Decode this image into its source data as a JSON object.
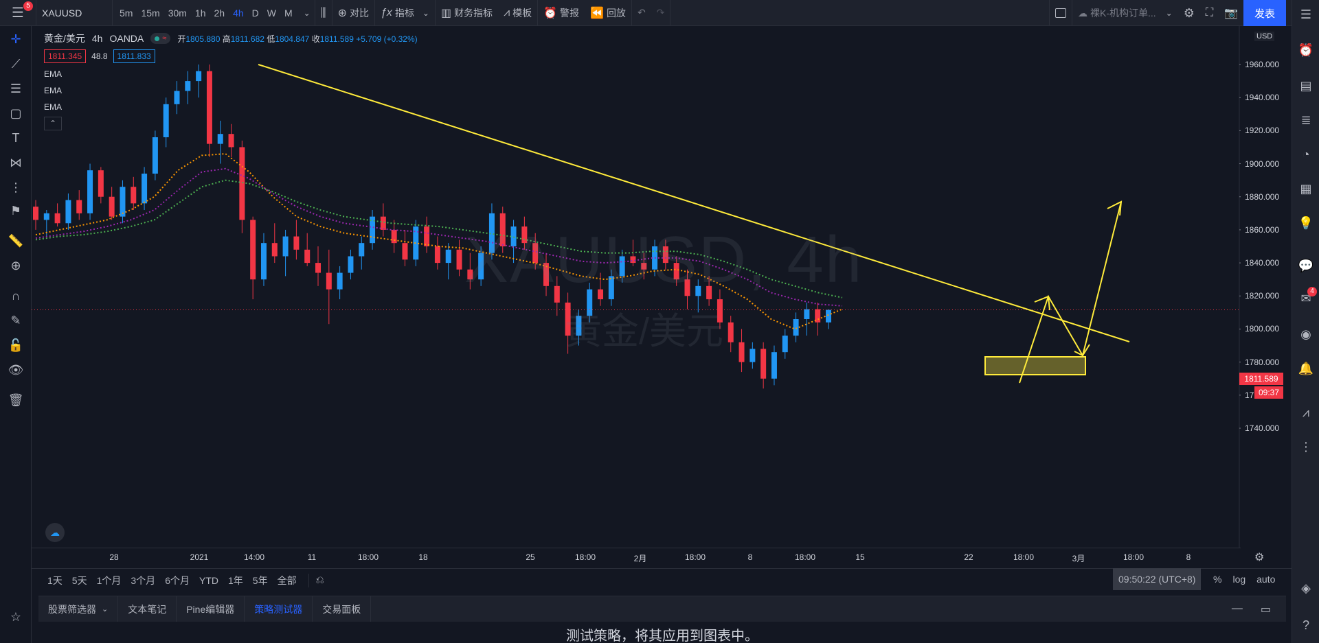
{
  "topbar": {
    "menu_badge": "5",
    "symbol": "XAUUSD",
    "timeframes": [
      "5m",
      "15m",
      "30m",
      "1h",
      "2h",
      "4h",
      "D",
      "W",
      "M"
    ],
    "active_timeframe": "4h",
    "compare_label": "对比",
    "indicators_label": "指标",
    "financials_label": "财务指标",
    "templates_label": "模板",
    "alerts_label": "警报",
    "replay_label": "回放",
    "layout_name": "裸K-机构订单...",
    "publish_label": "发表"
  },
  "legend": {
    "title": "黄金/美元",
    "interval": "4h",
    "broker": "OANDA",
    "open_label": "开",
    "open": "1805.880",
    "high_label": "高",
    "high": "1811.682",
    "low_label": "低",
    "low": "1804.847",
    "close_label": "收",
    "close": "1811.589",
    "change": "+5.709 (+0.32%)",
    "bid": "1811.345",
    "spread": "48.8",
    "ask": "1811.833",
    "indicators": [
      "EMA",
      "EMA",
      "EMA"
    ]
  },
  "watermark": {
    "symbol": "XAUUSD, 4h",
    "name": "黄金/美元"
  },
  "price_axis": {
    "currency": "USD",
    "labels": [
      "1960.000",
      "1940.000",
      "1920.000",
      "1900.000",
      "1880.000",
      "1860.000",
      "1840.000",
      "1820.000",
      "1800.000",
      "1780.000",
      "1760.000",
      "1740.000"
    ],
    "current_price": "1811.589",
    "countdown": "09:37"
  },
  "time_axis": {
    "labels": [
      "28",
      "2021",
      "14:00",
      "11",
      "18:00",
      "18",
      "25",
      "18:00",
      "2月",
      "18:00",
      "8",
      "18:00",
      "15",
      "22",
      "18:00",
      "3月",
      "18:00",
      "8"
    ]
  },
  "range_bar": {
    "ranges": [
      "1天",
      "5天",
      "1个月",
      "3个月",
      "6个月",
      "YTD",
      "1年",
      "5年",
      "全部"
    ],
    "clock": "09:50:22 (UTC+8)",
    "scale_percent": "%",
    "scale_log": "log",
    "scale_auto": "auto"
  },
  "bottom_panel": {
    "tabs": [
      "股票筛选器",
      "文本笔记",
      "Pine编辑器",
      "策略测试器",
      "交易面板"
    ],
    "active_tab": "策略测试器",
    "message": "测试策略，将其应用到图表中。"
  },
  "right_toolbar": {
    "badge": "4"
  },
  "colors": {
    "background": "#131722",
    "up": "#2196f3",
    "down": "#f23645",
    "ema_fast": "#ff9800",
    "ema_mid": "#9c27b0",
    "ema_slow": "#4caf50",
    "drawing": "#ffeb3b",
    "accent": "#2962ff"
  },
  "chart_data": {
    "type": "candlestick",
    "symbol": "XAUUSD",
    "interval": "4h",
    "ylim": [
      1730,
      1990
    ],
    "y_ticks": [
      1740,
      1760,
      1780,
      1800,
      1820,
      1840,
      1860,
      1880,
      1900,
      1920,
      1940,
      1960
    ],
    "last_price": 1811.589,
    "series": [
      {
        "name": "EMA",
        "color": "#ff9800",
        "values": [
          1857,
          1860,
          1863,
          1866,
          1872,
          1880,
          1896,
          1905,
          1906,
          1895,
          1880,
          1868,
          1862,
          1858,
          1856,
          1854,
          1852,
          1850,
          1849,
          1846,
          1843,
          1840,
          1836,
          1832,
          1830,
          1832,
          1835,
          1836,
          1833,
          1826,
          1818,
          1806,
          1800,
          1806,
          1812
        ]
      },
      {
        "name": "EMA",
        "color": "#9c27b0",
        "values": [
          1855,
          1857,
          1859,
          1862,
          1866,
          1872,
          1884,
          1895,
          1897,
          1891,
          1882,
          1874,
          1868,
          1864,
          1862,
          1860,
          1859,
          1857,
          1855,
          1853,
          1850,
          1847,
          1844,
          1841,
          1840,
          1841,
          1843,
          1843,
          1841,
          1836,
          1830,
          1822,
          1818,
          1815,
          1814
        ]
      },
      {
        "name": "EMA",
        "color": "#4caf50",
        "values": [
          1854,
          1856,
          1857,
          1859,
          1862,
          1866,
          1876,
          1886,
          1890,
          1888,
          1883,
          1877,
          1872,
          1868,
          1866,
          1864,
          1863,
          1862,
          1860,
          1858,
          1856,
          1853,
          1850,
          1847,
          1846,
          1846,
          1847,
          1847,
          1845,
          1841,
          1836,
          1830,
          1826,
          1822,
          1819
        ]
      }
    ],
    "candles": [
      [
        1874,
        1878,
        1860,
        1866
      ],
      [
        1866,
        1872,
        1856,
        1870
      ],
      [
        1870,
        1876,
        1862,
        1864
      ],
      [
        1864,
        1882,
        1860,
        1878
      ],
      [
        1878,
        1884,
        1866,
        1870
      ],
      [
        1870,
        1900,
        1866,
        1896
      ],
      [
        1896,
        1898,
        1876,
        1880
      ],
      [
        1880,
        1886,
        1866,
        1868
      ],
      [
        1868,
        1890,
        1864,
        1886
      ],
      [
        1886,
        1892,
        1872,
        1876
      ],
      [
        1876,
        1898,
        1872,
        1894
      ],
      [
        1894,
        1920,
        1890,
        1916
      ],
      [
        1916,
        1940,
        1910,
        1936
      ],
      [
        1936,
        1950,
        1930,
        1944
      ],
      [
        1944,
        1956,
        1936,
        1950
      ],
      [
        1950,
        1960,
        1940,
        1956
      ],
      [
        1956,
        1960,
        1904,
        1912
      ],
      [
        1912,
        1926,
        1900,
        1918
      ],
      [
        1918,
        1924,
        1904,
        1910
      ],
      [
        1910,
        1914,
        1858,
        1866
      ],
      [
        1866,
        1868,
        1818,
        1830
      ],
      [
        1830,
        1858,
        1826,
        1852
      ],
      [
        1852,
        1864,
        1840,
        1844
      ],
      [
        1844,
        1860,
        1832,
        1856
      ],
      [
        1856,
        1866,
        1842,
        1848
      ],
      [
        1848,
        1858,
        1838,
        1840
      ],
      [
        1840,
        1850,
        1826,
        1834
      ],
      [
        1834,
        1848,
        1803,
        1824
      ],
      [
        1824,
        1838,
        1818,
        1834
      ],
      [
        1834,
        1848,
        1830,
        1844
      ],
      [
        1844,
        1856,
        1836,
        1852
      ],
      [
        1852,
        1872,
        1848,
        1868
      ],
      [
        1868,
        1876,
        1856,
        1860
      ],
      [
        1860,
        1866,
        1846,
        1852
      ],
      [
        1852,
        1860,
        1838,
        1842
      ],
      [
        1842,
        1866,
        1838,
        1862
      ],
      [
        1862,
        1868,
        1846,
        1850
      ],
      [
        1850,
        1856,
        1836,
        1840
      ],
      [
        1840,
        1852,
        1830,
        1848
      ],
      [
        1848,
        1854,
        1832,
        1836
      ],
      [
        1836,
        1846,
        1824,
        1830
      ],
      [
        1830,
        1850,
        1826,
        1846
      ],
      [
        1846,
        1876,
        1842,
        1870
      ],
      [
        1870,
        1874,
        1846,
        1850
      ],
      [
        1850,
        1866,
        1840,
        1862
      ],
      [
        1862,
        1868,
        1848,
        1852
      ],
      [
        1852,
        1858,
        1836,
        1840
      ],
      [
        1840,
        1846,
        1820,
        1826
      ],
      [
        1826,
        1832,
        1808,
        1816
      ],
      [
        1816,
        1822,
        1785,
        1796
      ],
      [
        1796,
        1812,
        1790,
        1808
      ],
      [
        1808,
        1828,
        1804,
        1824
      ],
      [
        1824,
        1834,
        1814,
        1818
      ],
      [
        1818,
        1836,
        1814,
        1832
      ],
      [
        1832,
        1848,
        1828,
        1844
      ],
      [
        1844,
        1854,
        1838,
        1840
      ],
      [
        1840,
        1846,
        1830,
        1836
      ],
      [
        1836,
        1854,
        1832,
        1850
      ],
      [
        1850,
        1854,
        1836,
        1840
      ],
      [
        1840,
        1844,
        1826,
        1830
      ],
      [
        1830,
        1836,
        1812,
        1820
      ],
      [
        1820,
        1830,
        1810,
        1826
      ],
      [
        1826,
        1832,
        1814,
        1818
      ],
      [
        1818,
        1824,
        1800,
        1804
      ],
      [
        1804,
        1808,
        1786,
        1792
      ],
      [
        1792,
        1800,
        1774,
        1780
      ],
      [
        1780,
        1792,
        1776,
        1788
      ],
      [
        1788,
        1792,
        1764,
        1770
      ],
      [
        1770,
        1790,
        1766,
        1786
      ],
      [
        1786,
        1800,
        1782,
        1796
      ],
      [
        1796,
        1810,
        1792,
        1806
      ],
      [
        1806,
        1816,
        1796,
        1812
      ],
      [
        1812,
        1816,
        1796,
        1804
      ],
      [
        1804,
        1812,
        1800,
        1811.589
      ]
    ],
    "annotations": [
      {
        "type": "trendline",
        "from": [
          1960,
          "14:00"
        ],
        "to": [
          1791,
          "3月 18:00"
        ]
      },
      {
        "type": "rectangle",
        "price_range": [
          1802,
          1811
        ]
      },
      {
        "type": "path",
        "note": "projection arrows up to 1900"
      }
    ]
  }
}
